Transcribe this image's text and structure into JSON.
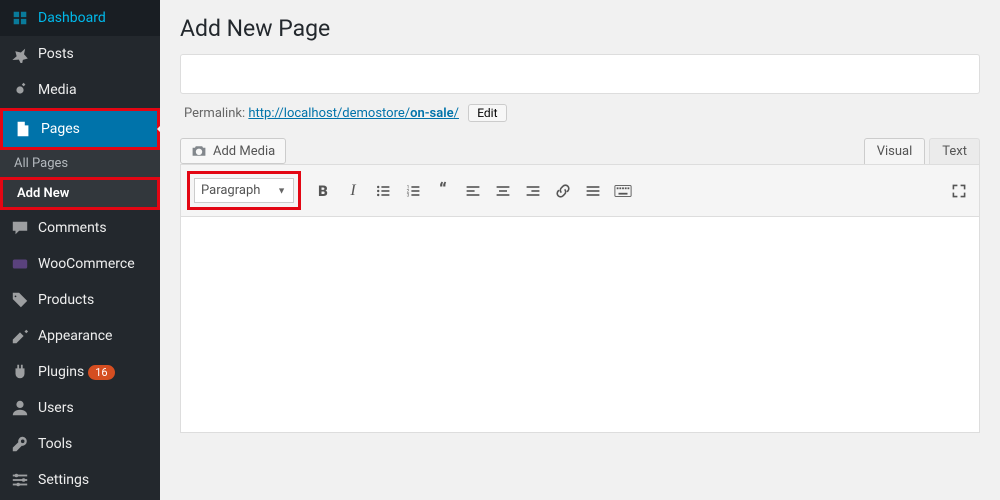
{
  "sidebar": {
    "items": [
      {
        "label": "Dashboard",
        "icon": "dashboard"
      },
      {
        "label": "Posts",
        "icon": "pin"
      },
      {
        "label": "Media",
        "icon": "media"
      },
      {
        "label": "Pages",
        "icon": "pages",
        "active": true,
        "highlight": true
      },
      {
        "label": "Comments",
        "icon": "comment"
      },
      {
        "label": "WooCommerce",
        "icon": "woo"
      },
      {
        "label": "Products",
        "icon": "product"
      },
      {
        "label": "Appearance",
        "icon": "appearance"
      },
      {
        "label": "Plugins",
        "icon": "plugin",
        "badge": "16"
      },
      {
        "label": "Users",
        "icon": "users"
      },
      {
        "label": "Tools",
        "icon": "tools"
      },
      {
        "label": "Settings",
        "icon": "settings"
      }
    ],
    "subitems": [
      {
        "label": "All Pages"
      },
      {
        "label": "Add New",
        "current": true,
        "highlight": true
      }
    ]
  },
  "page": {
    "title": "Add New Page",
    "title_input_value": "",
    "permalink_label": "Permalink:",
    "permalink_base": "http://localhost/demostore/",
    "permalink_slug": "on-sale",
    "permalink_trail": "/",
    "edit_label": "Edit",
    "add_media_label": "Add Media"
  },
  "editor": {
    "tabs": [
      {
        "label": "Visual",
        "active": true
      },
      {
        "label": "Text"
      }
    ],
    "format_select": "Paragraph"
  }
}
